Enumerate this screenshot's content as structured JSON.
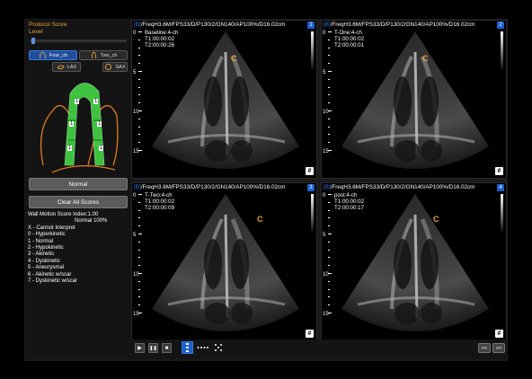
{
  "left_panel": {
    "protocol_score": "Protocol Score",
    "level": "Level",
    "views": [
      {
        "label": "Four_ch",
        "icon": "heart-four-chamber-icon",
        "active": true
      },
      {
        "label": "Two_ch",
        "icon": "heart-two-chamber-icon",
        "active": false
      },
      {
        "label": "LAX",
        "icon": "heart-lax-icon",
        "active": false
      },
      {
        "label": "SAX",
        "icon": "heart-sax-icon",
        "active": false
      }
    ],
    "segment_scores": [
      "1",
      "1",
      "1",
      "1",
      "1",
      "1"
    ],
    "normal_button": "Normal",
    "clear_button": "Clear All Scores",
    "wmsi_label": "Wall Motion Score Index:1.00",
    "normal_pct": "Normal 100%",
    "legend": [
      "X - Cannot Interpret",
      "0 - Hyperkinetic",
      "1 - Normal",
      "2 - Hypokinetic",
      "3 - Akinetic",
      "4 - Dyskinetic",
      "5 - Aneurysmal",
      "6 - Akinetic w/scar",
      "7 - Dyskinetic w/scar"
    ]
  },
  "panels": [
    {
      "num": "1",
      "prefix": "[B]",
      "header": "/FreqH3.6M/FPS33/D/P130/2/GN140/AP100%/D16.02cm",
      "name": "Baseline:4-ch",
      "t1": "T1:00:00:02",
      "t2": "T2:00:00:26",
      "marker": "C"
    },
    {
      "num": "2",
      "prefix": "[B]",
      "header": "/FreqH3.6M/FPS33/D/P130/2/GN140/AP100%/D16.02cm",
      "name": "T-One:4-ch",
      "t1": "T1:00:00:02",
      "t2": "T2:00:00:01",
      "marker": "C"
    },
    {
      "num": "3",
      "prefix": "[B]",
      "header": "/FreqH3.6M/FPS33/D/P130/2/GN140/AP100%/D16.02cm",
      "name": "T-Two:4-ch",
      "t1": "T1:00:00:02",
      "t2": "T2:00:00:09",
      "marker": "C"
    },
    {
      "num": "4",
      "prefix": "[B]",
      "header": "/FreqH3.6M/FPS33/D/P130/2/GN140/AP100%/D16.02cm",
      "name": "post:4-ch",
      "t1": "T1:00:00:02",
      "t2": "T2:00:00:17",
      "marker": "C"
    }
  ],
  "depth_scale": [
    "0",
    "5",
    "10",
    "15"
  ],
  "panel_icon": "#",
  "bottom_bar": {
    "controls": [
      {
        "icon": "play-icon",
        "glyph": "▶"
      },
      {
        "icon": "pause-icon",
        "glyph": "❚❚"
      },
      {
        "icon": "stop-icon",
        "glyph": "■"
      }
    ],
    "prev": "<<",
    "next": ">>"
  }
}
